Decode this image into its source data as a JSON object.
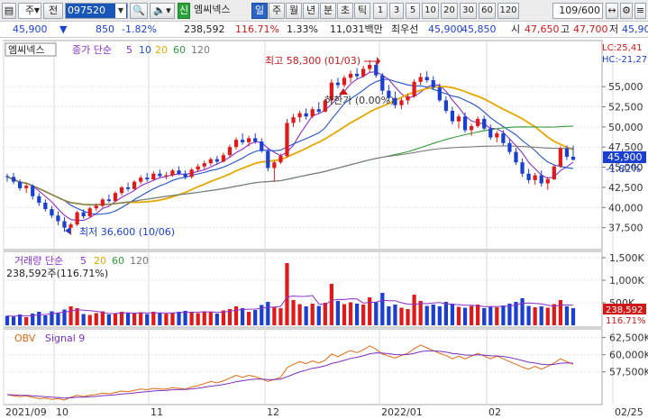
{
  "toolbar": {
    "market": "주",
    "jeon_label": "전",
    "stock_code": "097520",
    "badge": "신",
    "stock_name": "엠씨넥스",
    "periods": [
      "일",
      "주",
      "월",
      "년",
      "분",
      "초",
      "틱"
    ],
    "selected_period": "일",
    "intervals": [
      "1",
      "3",
      "5",
      "10",
      "20",
      "30",
      "60",
      "120"
    ],
    "count": "109",
    "count_total": "/600",
    "colors": {
      "code_bg": "#1a56b7",
      "badge": "#29a339",
      "selected": "#2b63c6"
    }
  },
  "quote": {
    "price": "45,900",
    "change": "850",
    "change_pct": "-1.82%",
    "volume": "238,592",
    "vol_ratio": "116.71%",
    "turnover_pct": "1.33%",
    "amount": "11,031백만",
    "best_label": "최우선",
    "ask": "45,900",
    "bid": "45,850",
    "open_label": "시",
    "open": "47,650",
    "high_label": "고",
    "high": "47,700",
    "low_label": "저",
    "low": "45,900"
  },
  "price_panel": {
    "legend_name": "엠씨넥스",
    "legend_ma": "종가 단순",
    "ma_periods": [
      "5",
      "10",
      "20",
      "60",
      "120"
    ],
    "ma_colors": [
      "#8b2fc9",
      "#2450c8",
      "#e6a800",
      "#2e9a3a",
      "#7a7a7a"
    ],
    "high_annotation": "최고 58,300 (01/03)",
    "low_annotation": "최저 36,600 (10/06)",
    "limit_annotation": "하한가 (0.00%)",
    "lc_label": "LC:25,41",
    "hc_label": "HC:-21,27",
    "last_price": "45,900",
    "last_change": "-1.82%",
    "y_ticks": [
      "55,000",
      "52,500",
      "50,000",
      "47,500",
      "45,000",
      "42,500",
      "40,000",
      "37,500"
    ]
  },
  "volume_panel": {
    "legend": "거래량 단순",
    "ma_periods": [
      "5",
      "20",
      "60",
      "120"
    ],
    "value_text": "238,592주(116.71%)",
    "y_ticks": [
      "1,500K",
      "1,000K",
      "500K"
    ],
    "last_volume": "238,592",
    "last_pct": "116.71%"
  },
  "obv_panel": {
    "legend_obv": "OBV",
    "legend_signal": "Signal 9",
    "y_ticks": [
      "62,500K",
      "60,000K",
      "57,500K"
    ]
  },
  "x_axis": {
    "labels": [
      "2021/09",
      "10",
      "11",
      "12",
      "2022/01",
      "02",
      "02/25"
    ]
  },
  "chart_data": {
    "type": "candlestick",
    "ylim": [
      35000,
      60500
    ],
    "series_ohlc": [
      [
        43900,
        44200,
        43200,
        43800
      ],
      [
        43800,
        44300,
        42900,
        43200
      ],
      [
        43200,
        43500,
        42100,
        42400
      ],
      [
        42400,
        43000,
        41800,
        42700
      ],
      [
        42700,
        42900,
        41000,
        41400
      ],
      [
        41400,
        41800,
        40200,
        40600
      ],
      [
        40600,
        41000,
        39500,
        39800
      ],
      [
        39800,
        40200,
        38700,
        39000
      ],
      [
        39000,
        39500,
        37800,
        38300
      ],
      [
        38300,
        38800,
        37000,
        37500
      ],
      [
        37500,
        38100,
        36600,
        37900
      ],
      [
        37900,
        39600,
        37700,
        39400
      ],
      [
        39400,
        39800,
        38600,
        38900
      ],
      [
        38900,
        40100,
        38700,
        39900
      ],
      [
        39900,
        40500,
        39600,
        40200
      ],
      [
        40200,
        41200,
        40000,
        41000
      ],
      [
        41000,
        41600,
        40600,
        40800
      ],
      [
        40800,
        42000,
        40700,
        41800
      ],
      [
        41800,
        42700,
        41500,
        42500
      ],
      [
        42500,
        43100,
        42000,
        42300
      ],
      [
        42300,
        43400,
        42200,
        43200
      ],
      [
        43200,
        44000,
        42900,
        43700
      ],
      [
        43700,
        44300,
        43200,
        43500
      ],
      [
        43500,
        44500,
        43300,
        44200
      ],
      [
        44200,
        44700,
        43700,
        43900
      ],
      [
        43900,
        44400,
        43500,
        44000
      ],
      [
        44000,
        44800,
        43800,
        44600
      ],
      [
        44600,
        45100,
        44000,
        44200
      ],
      [
        44200,
        44600,
        43500,
        43800
      ],
      [
        43800,
        44900,
        43600,
        44700
      ],
      [
        44700,
        45400,
        44400,
        45100
      ],
      [
        45100,
        45800,
        44700,
        45500
      ],
      [
        45500,
        46200,
        45200,
        46000
      ],
      [
        46000,
        46400,
        45300,
        45700
      ],
      [
        45700,
        46800,
        45600,
        46500
      ],
      [
        46500,
        47800,
        46300,
        47500
      ],
      [
        47500,
        48700,
        47200,
        48400
      ],
      [
        48400,
        49200,
        47800,
        48100
      ],
      [
        48100,
        48900,
        47600,
        48600
      ],
      [
        48600,
        49200,
        47900,
        48200
      ],
      [
        48200,
        48600,
        46800,
        47000
      ],
      [
        47000,
        47300,
        44500,
        44900
      ],
      [
        44900,
        45800,
        43200,
        45600
      ],
      [
        45600,
        46700,
        45400,
        46400
      ],
      [
        46400,
        51000,
        46200,
        50500
      ],
      [
        50500,
        51600,
        50000,
        51200
      ],
      [
        51200,
        52000,
        50600,
        51700
      ],
      [
        51700,
        52300,
        50900,
        51300
      ],
      [
        51300,
        52500,
        51100,
        52200
      ],
      [
        52200,
        53100,
        51700,
        51900
      ],
      [
        51900,
        53500,
        51800,
        53300
      ],
      [
        53300,
        55900,
        53000,
        55500
      ],
      [
        55500,
        56100,
        54800,
        55200
      ],
      [
        55200,
        56400,
        54900,
        56100
      ],
      [
        56100,
        57000,
        55500,
        56600
      ],
      [
        56600,
        57300,
        55900,
        56300
      ],
      [
        56300,
        57600,
        56100,
        57200
      ],
      [
        57200,
        58300,
        56800,
        57700
      ],
      [
        57700,
        58100,
        56100,
        56400
      ],
      [
        56400,
        56700,
        54000,
        54500
      ],
      [
        54500,
        55200,
        53200,
        53600
      ],
      [
        53600,
        54400,
        52300,
        52700
      ],
      [
        52700,
        53600,
        52200,
        53300
      ],
      [
        53300,
        54100,
        52800,
        53800
      ],
      [
        53800,
        55900,
        53600,
        55600
      ],
      [
        55600,
        56700,
        55200,
        56200
      ],
      [
        56200,
        56900,
        55500,
        55800
      ],
      [
        55800,
        56300,
        54600,
        54900
      ],
      [
        54900,
        55400,
        53100,
        53300
      ],
      [
        53300,
        53800,
        51700,
        52000
      ],
      [
        52000,
        52500,
        50300,
        50700
      ],
      [
        50700,
        51600,
        49800,
        51300
      ],
      [
        51300,
        51800,
        49300,
        49600
      ],
      [
        49600,
        50400,
        48900,
        50100
      ],
      [
        50100,
        51300,
        49900,
        51000
      ],
      [
        51000,
        51400,
        49600,
        49800
      ],
      [
        49800,
        50300,
        48400,
        48700
      ],
      [
        48700,
        49500,
        48100,
        49200
      ],
      [
        49200,
        49600,
        47700,
        48000
      ],
      [
        48000,
        48500,
        46600,
        46900
      ],
      [
        46900,
        47400,
        45300,
        45600
      ],
      [
        45600,
        46100,
        43800,
        44200
      ],
      [
        44200,
        44800,
        43000,
        43400
      ],
      [
        43400,
        44300,
        42800,
        44000
      ],
      [
        44000,
        44600,
        42600,
        43000
      ],
      [
        43000,
        43800,
        42200,
        43500
      ],
      [
        43500,
        45300,
        43400,
        45100
      ],
      [
        45100,
        47600,
        44900,
        47300
      ],
      [
        47300,
        47700,
        45900,
        46300
      ],
      [
        46300,
        47700,
        45900,
        45900
      ]
    ],
    "volume": [
      210,
      190,
      240,
      180,
      260,
      300,
      220,
      310,
      280,
      350,
      420,
      380,
      250,
      230,
      270,
      310,
      240,
      260,
      300,
      280,
      260,
      290,
      250,
      300,
      270,
      260,
      280,
      300,
      320,
      290,
      270,
      310,
      300,
      260,
      330,
      360,
      420,
      380,
      300,
      340,
      450,
      520,
      410,
      380,
      1380,
      560,
      470,
      420,
      480,
      430,
      500,
      920,
      540,
      470,
      510,
      480,
      460,
      620,
      510,
      720,
      420,
      460,
      390,
      360,
      680,
      540,
      430,
      460,
      420,
      520,
      480,
      410,
      390,
      430,
      460,
      380,
      420,
      400,
      440,
      480,
      520,
      600,
      430,
      400,
      420,
      390,
      470,
      560,
      420,
      380
    ],
    "obv_k": [
      54200,
      54000,
      53900,
      54000,
      53800,
      53600,
      53700,
      53500,
      53600,
      53400,
      53800,
      54100,
      53900,
      54100,
      54200,
      54400,
      54300,
      54500,
      54700,
      54600,
      54800,
      55000,
      54900,
      55100,
      55000,
      55000,
      55200,
      55100,
      55000,
      55300,
      55500,
      55800,
      56100,
      55900,
      56200,
      56600,
      57000,
      56700,
      57000,
      56800,
      56500,
      56100,
      56400,
      56700,
      58100,
      58600,
      59000,
      58700,
      59100,
      58800,
      59200,
      60100,
      59700,
      60200,
      60600,
      60300,
      60700,
      61300,
      60800,
      60100,
      59800,
      59500,
      59900,
      60200,
      60900,
      61400,
      61000,
      60600,
      60200,
      59900,
      59400,
      59800,
      59400,
      59800,
      60200,
      59800,
      59400,
      59800,
      59400,
      59000,
      58600,
      58200,
      57900,
      58300,
      57900,
      58300,
      58800,
      59400,
      59000,
      58600
    ]
  }
}
